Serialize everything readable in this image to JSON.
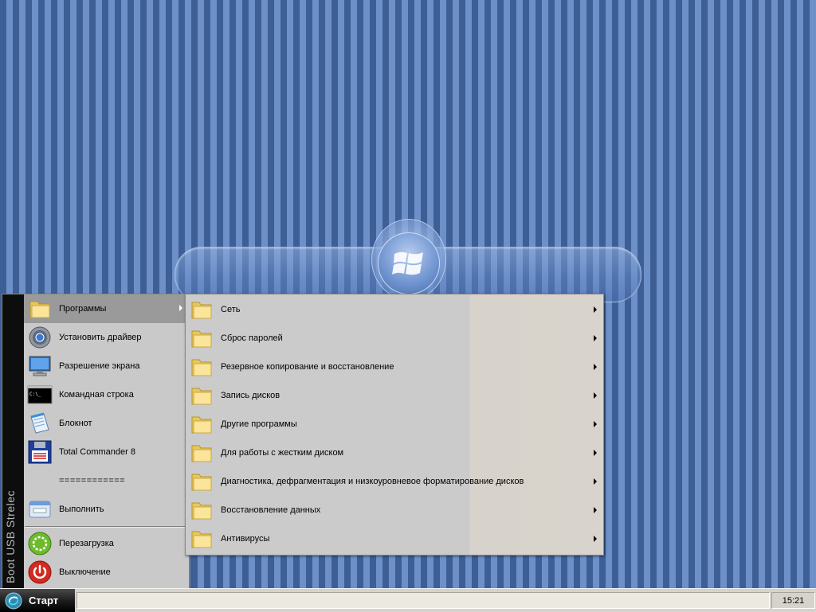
{
  "menu": {
    "strip_label": "Boot USB Strelec",
    "items": [
      {
        "label": "Программы",
        "icon": "folder-icon",
        "has_submenu": true
      },
      {
        "label": "Установить драйвер",
        "icon": "gear-driver-icon"
      },
      {
        "label": "Разрешение экрана",
        "icon": "monitor-icon"
      },
      {
        "label": "Командная строка",
        "icon": "command-prompt-icon"
      },
      {
        "label": "Блокнот",
        "icon": "notepad-icon"
      },
      {
        "label": "Total Commander 8",
        "icon": "floppy-disk-icon"
      },
      {
        "label": "============"
      },
      {
        "label": "Выполнить",
        "icon": "run-window-icon"
      },
      {
        "label": "Перезагрузка",
        "icon": "restart-icon"
      },
      {
        "label": "Выключение",
        "icon": "power-icon"
      }
    ]
  },
  "submenu": {
    "items": [
      {
        "label": "Сеть"
      },
      {
        "label": "Сброс паролей"
      },
      {
        "label": "Резервное копирование и восстановление"
      },
      {
        "label": "Запись дисков"
      },
      {
        "label": "Другие программы"
      },
      {
        "label": "Для работы с жестким диском"
      },
      {
        "label": "Диагностика, дефрагментация и низкоуровневое форматирование дисков"
      },
      {
        "label": "Восстановление данных"
      },
      {
        "label": "Антивирусы"
      }
    ]
  },
  "taskbar": {
    "start_label": "Старт",
    "clock": "15:21"
  },
  "colors": {
    "desktop_stripe_dark": "#3d5f96",
    "desktop_stripe_light": "#6d90c8",
    "menu_bg": "#c9c9c9",
    "menu_highlight": "#9a9a9a",
    "strip_bg": "#0d0d0d"
  }
}
